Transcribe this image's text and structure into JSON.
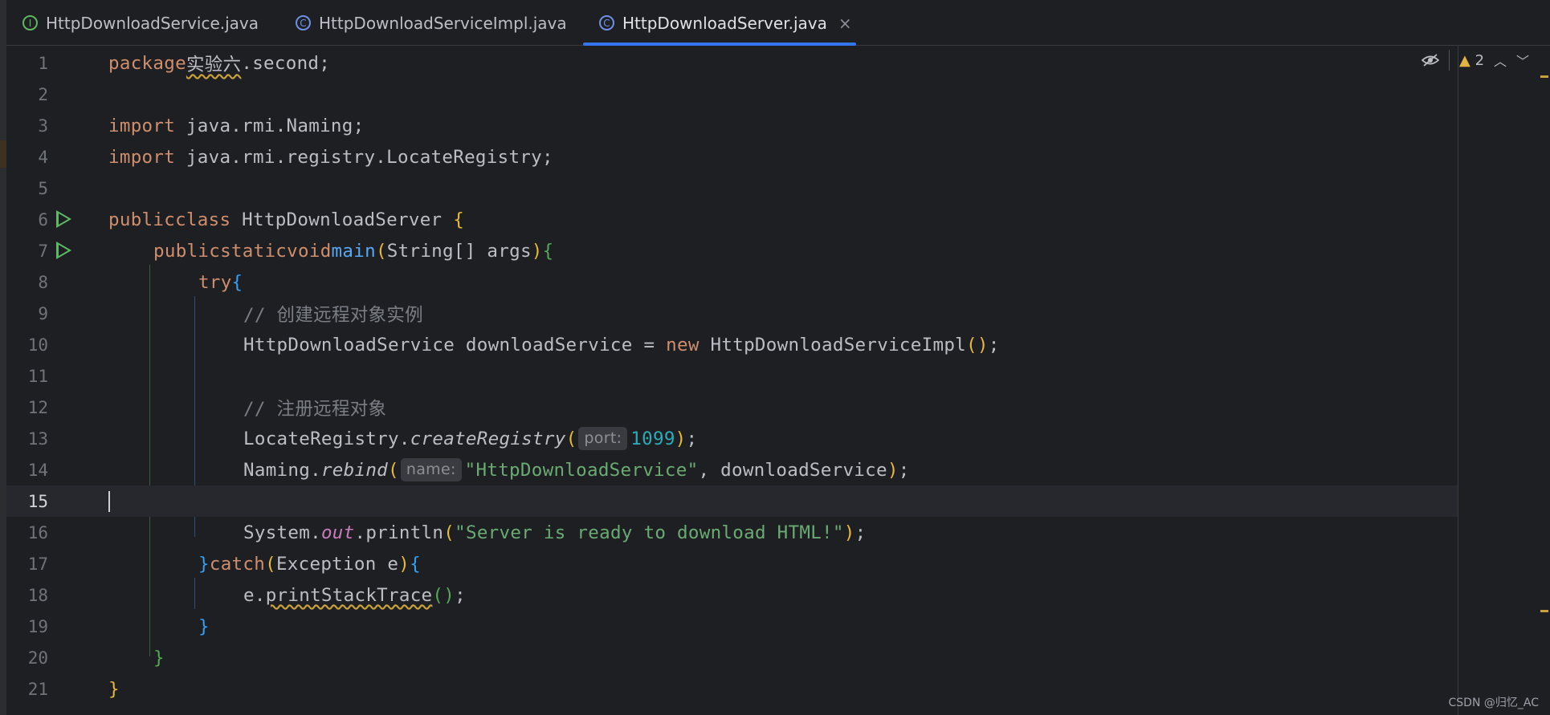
{
  "tabs": [
    {
      "label": "HttpDownloadService.java",
      "icon": "interface-icon",
      "glyph": "I"
    },
    {
      "label": "HttpDownloadServiceImpl.java",
      "icon": "class-icon",
      "glyph": "C"
    },
    {
      "label": "HttpDownloadServer.java",
      "icon": "class-icon",
      "glyph": "C",
      "active": true,
      "close": "×"
    }
  ],
  "line_numbers": [
    "1",
    "2",
    "3",
    "4",
    "5",
    "6",
    "7",
    "8",
    "9",
    "10",
    "11",
    "12",
    "13",
    "14",
    "15",
    "16",
    "17",
    "18",
    "19",
    "20",
    "21"
  ],
  "code": {
    "l1": {
      "kw": "package",
      "pkg": "实验六",
      "rest": ".second;"
    },
    "l3": {
      "kw": "import",
      "rest": " java.rmi.Naming;"
    },
    "l4": {
      "kw": "import",
      "rest": " java.rmi.registry.LocateRegistry;"
    },
    "l6": {
      "kw1": "public",
      "kw2": "class",
      "name": " HttpDownloadServer ",
      "brace": "{"
    },
    "l7": {
      "kw1": "public",
      "kw2": "static",
      "kw3": "void",
      "fn": "main",
      "open": "(",
      "args": "String[] args",
      "close": ")",
      "brace": "{"
    },
    "l8": {
      "kw": "try",
      "brace": "{"
    },
    "l9": {
      "comment": "// 创建远程对象实例"
    },
    "l10": {
      "a": "HttpDownloadService downloadService = ",
      "kw": "new",
      "b": " HttpDownloadServiceImpl",
      "paren": "()",
      "semi": ";"
    },
    "l12": {
      "comment": "// 注册远程对象"
    },
    "l13": {
      "obj": "LocateRegistry.",
      "method": "createRegistry",
      "open": "(",
      "hint": "port:",
      "num": "1099",
      "close": ")",
      "semi": ";"
    },
    "l14": {
      "obj": "Naming.",
      "method": "rebind",
      "open": "(",
      "hint": "name:",
      "str": "\"HttpDownloadService\"",
      "rest": ", downloadService",
      "close": ")",
      "semi": ";"
    },
    "l16": {
      "obj": "System.",
      "field": "out",
      "call": ".println",
      "open": "(",
      "str": "\"Server is ready to download HTML!\"",
      "close": ")",
      "semi": ";"
    },
    "l17": {
      "brace_close": "}",
      "kw": "catch",
      "open": "(",
      "args": "Exception e",
      "close": ")",
      "brace": "{"
    },
    "l18": {
      "obj": "e.",
      "method": "printStackTrace",
      "paren": "()",
      "semi": ";"
    },
    "l19": {
      "brace": "}"
    },
    "l20": {
      "brace": "}"
    },
    "l21": {
      "brace": "}"
    }
  },
  "inspections": {
    "warning_count": "2"
  },
  "watermark": "CSDN @归忆_AC",
  "colors": {
    "background": "#1e1f22",
    "keyword": "#cf8e6d",
    "string": "#6aab73",
    "number": "#2aacb8",
    "function": "#56a8f5",
    "accent": "#3574f0"
  }
}
